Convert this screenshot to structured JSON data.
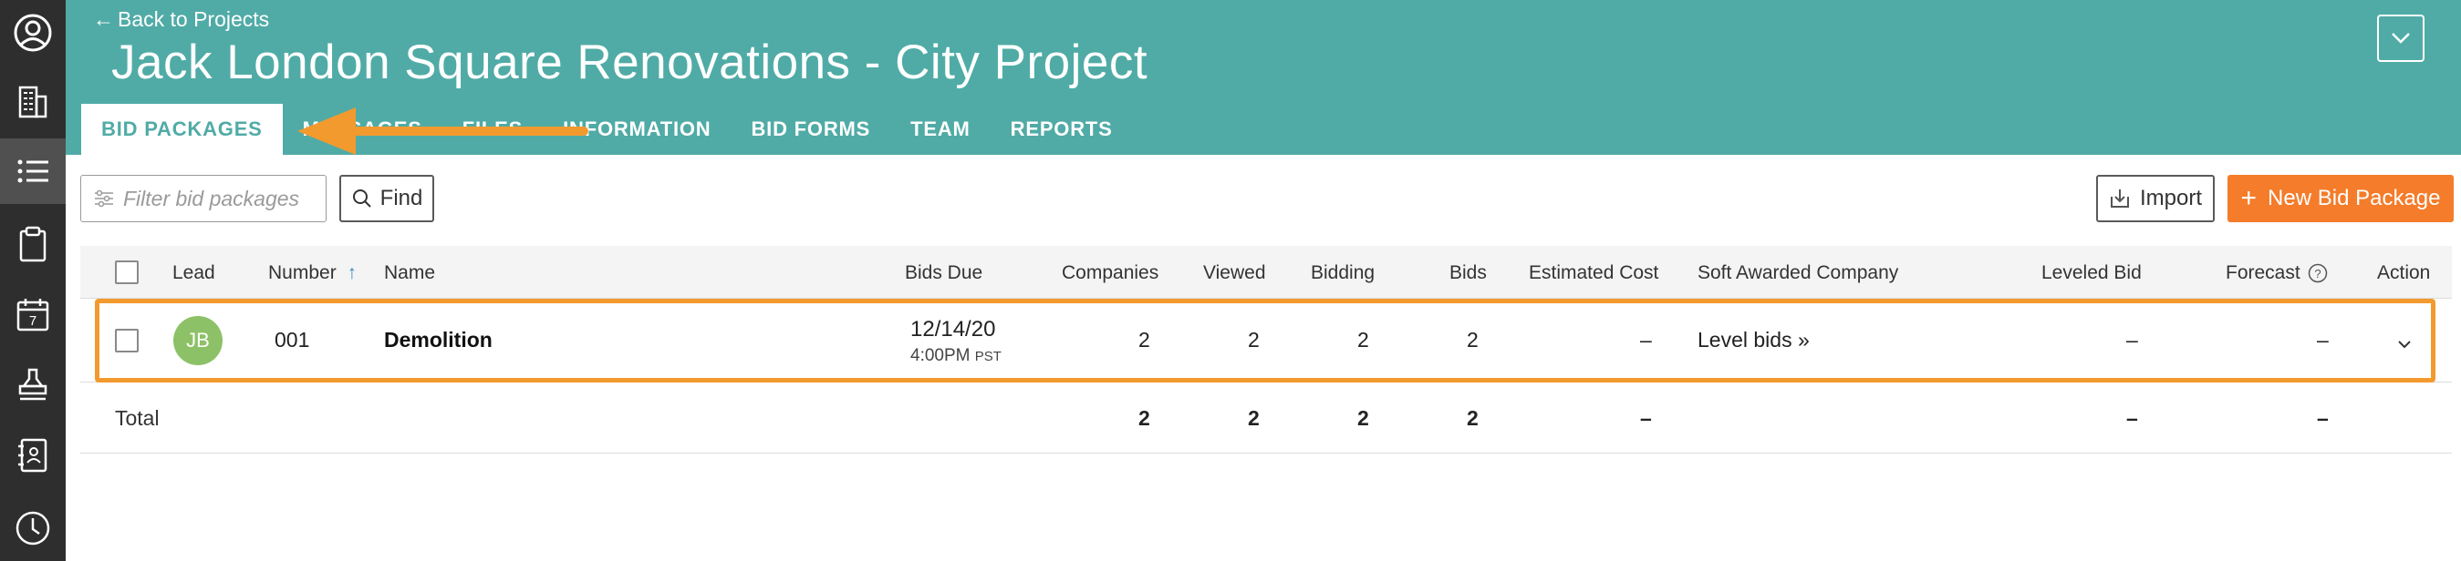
{
  "rail": {
    "icons": [
      "profile-icon",
      "company-icon",
      "list-icon",
      "clipboard-icon",
      "calendar-icon",
      "stamp-icon",
      "contacts-book-icon",
      "clock-icon"
    ],
    "calendar_day": "7"
  },
  "header": {
    "back_label": "Back to Projects",
    "title": "Jack London Square Renovations - City Project",
    "tabs": [
      "BID PACKAGES",
      "MESSAGES",
      "FILES",
      "INFORMATION",
      "BID FORMS",
      "TEAM",
      "REPORTS"
    ]
  },
  "toolbar": {
    "filter_placeholder": "Filter bid packages",
    "find_label": "Find",
    "import_label": "Import",
    "new_label": "New Bid Package"
  },
  "table": {
    "columns": {
      "lead": "Lead",
      "number": "Number",
      "sort_indicator": "↑",
      "name": "Name",
      "bids_due": "Bids Due",
      "companies": "Companies",
      "viewed": "Viewed",
      "bidding": "Bidding",
      "bids": "Bids",
      "estimated_cost": "Estimated Cost",
      "soft_awarded": "Soft Awarded Company",
      "leveled_bid": "Leveled Bid",
      "forecast": "Forecast",
      "action": "Action"
    },
    "rows": [
      {
        "lead_initials": "JB",
        "number": "001",
        "name": "Demolition",
        "due_date": "12/14/20",
        "due_time": "4:00PM",
        "due_tz": "PST",
        "companies": "2",
        "viewed": "2",
        "bidding": "2",
        "bids": "2",
        "estimated_cost": "–",
        "soft_awarded_link": "Level bids »",
        "leveled_bid": "–",
        "forecast": "–"
      }
    ],
    "total": {
      "label": "Total",
      "companies": "2",
      "viewed": "2",
      "bidding": "2",
      "bids": "2",
      "estimated_cost": "–",
      "leveled_bid": "–",
      "forecast": "–"
    }
  },
  "colors": {
    "header_bg": "#50aba6",
    "rail_bg": "#2e2e2e",
    "accent_orange": "#f47c2a",
    "link_blue": "#3d8fc5",
    "avatar_green": "#8dc167"
  }
}
